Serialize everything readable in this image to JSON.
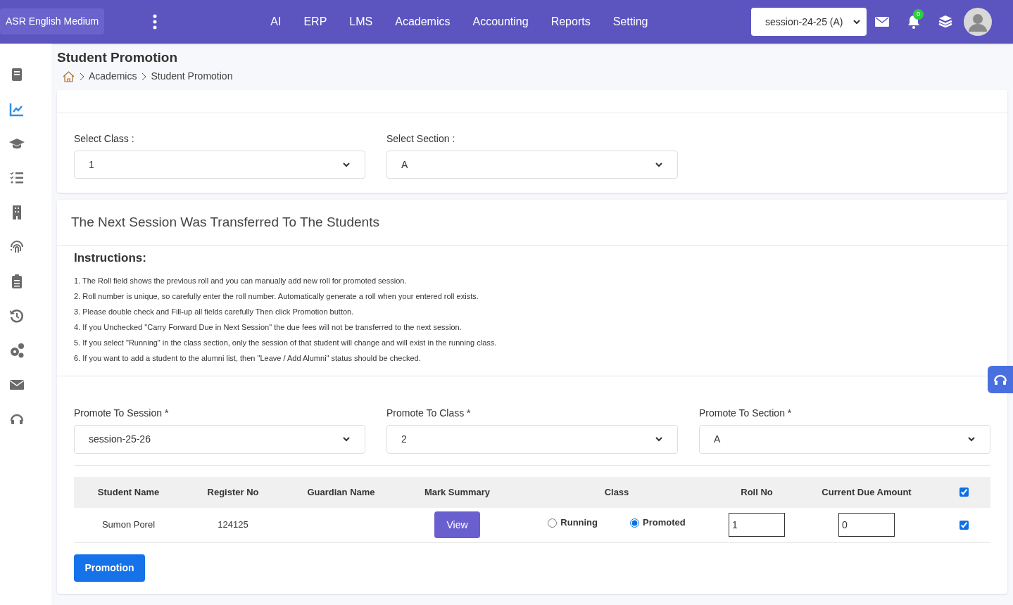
{
  "brand": "ASR English Medium",
  "nav": [
    "AI",
    "ERP",
    "LMS",
    "Academics",
    "Accounting",
    "Reports",
    "Setting"
  ],
  "session_select": "session-24-25 (A)",
  "notification_count": "0",
  "sidebar": {
    "items": [
      {
        "selected": false
      },
      {
        "selected": true
      },
      {
        "selected": false
      },
      {
        "selected": false
      },
      {
        "selected": false
      },
      {
        "selected": false
      },
      {
        "selected": false
      },
      {
        "selected": false
      },
      {
        "selected": false
      },
      {
        "selected": false
      },
      {
        "selected": false
      }
    ]
  },
  "page_title": "Student Promotion",
  "breadcrumb": [
    "Academics",
    "Student Promotion"
  ],
  "filters": [
    {
      "label": "Select Class :",
      "value": "1"
    },
    {
      "label": "Select Section :",
      "value": "A"
    }
  ],
  "panel_title": "The Next Session Was Transferred To The Students",
  "instructions_title": "Instructions:",
  "instructions": [
    "1. The Roll field shows the previous roll and you can manually add new roll for promoted session.",
    "2. Roll number is unique, so carefully enter the roll number. Automatically generate a roll when your entered roll exists.",
    "3. Please double check and Fill-up all fields carefully Then click Promotion button.",
    "4. If you Unchecked \"Carry Forward Due in Next Session\" the due fees will not be transferred to the next session.",
    "5. If you select \"Running\" in the class section, only the session of that student will change and will exist in the running class.",
    "6. If you want to add a student to the alumni list, then \"Leave / Add Alumni\" status should be checked."
  ],
  "promote": [
    {
      "label": "Promote To Session *",
      "value": "session-25-26"
    },
    {
      "label": "Promote To Class *",
      "value": "2"
    },
    {
      "label": "Promote To Section *",
      "value": "A"
    }
  ],
  "table": {
    "columns": [
      "Student Name",
      "Register No",
      "Guardian Name",
      "Mark Summary",
      "Class",
      "Roll No",
      "Current Due Amount"
    ],
    "select_all_checked": true,
    "rows": [
      {
        "student_name": "Sumon Porel",
        "register_no": "124125",
        "mark_button": "View",
        "class_options": [
          {
            "label": "Running",
            "selected": false
          },
          {
            "label": "Promoted",
            "selected": true
          }
        ],
        "roll_no": "1",
        "due_amount": "0",
        "checked": true
      }
    ]
  },
  "submit_button": "Promotion"
}
